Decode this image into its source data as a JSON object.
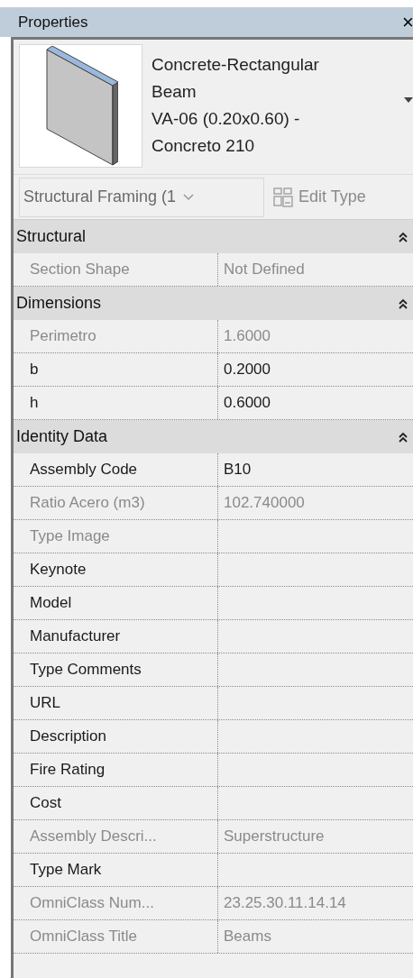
{
  "window": {
    "title": "Properties",
    "close": "×"
  },
  "type_selector": {
    "lines": [
      "Concrete-Rectangular",
      "Beam",
      "VA-06 (0.20x0.60) -",
      "Concreto 210"
    ]
  },
  "filter": {
    "value": "Structural Framing (1",
    "edit_type": {
      "label": "Edit Type",
      "disabled": true
    }
  },
  "groups": [
    {
      "title": "Structural",
      "expanded": true,
      "rows": [
        {
          "label": "Section Shape",
          "value": "Not Defined",
          "disabled": true
        }
      ]
    },
    {
      "title": "Dimensions",
      "expanded": true,
      "rows": [
        {
          "label": "Perimetro",
          "value": "1.6000",
          "disabled": true
        },
        {
          "label": "b",
          "value": "0.2000",
          "disabled": false
        },
        {
          "label": "h",
          "value": "0.6000",
          "disabled": false
        }
      ]
    },
    {
      "title": "Identity Data",
      "expanded": true,
      "rows": [
        {
          "label": "Assembly Code",
          "value": "B10",
          "disabled": false
        },
        {
          "label": "Ratio Acero (m3)",
          "value": "102.740000",
          "disabled": true
        },
        {
          "label": "Type Image",
          "disabled": true
        },
        {
          "label": "Keynote",
          "disabled": false
        },
        {
          "label": "Model",
          "disabled": false
        },
        {
          "label": "Manufacturer",
          "disabled": false
        },
        {
          "label": "Type Comments",
          "disabled": false
        },
        {
          "label": "URL",
          "disabled": false
        },
        {
          "label": "Description",
          "disabled": false
        },
        {
          "label": "Fire Rating",
          "disabled": false
        },
        {
          "label": "Cost",
          "disabled": false
        },
        {
          "label": "Assembly Descri...",
          "value": "Superstructure",
          "disabled": true
        },
        {
          "label": "Type Mark",
          "disabled": false
        },
        {
          "label": "OmniClass Num...",
          "value": "23.25.30.11.14.14",
          "disabled": true
        },
        {
          "label": "OmniClass Title",
          "value": "Beams",
          "disabled": true
        }
      ]
    }
  ]
}
